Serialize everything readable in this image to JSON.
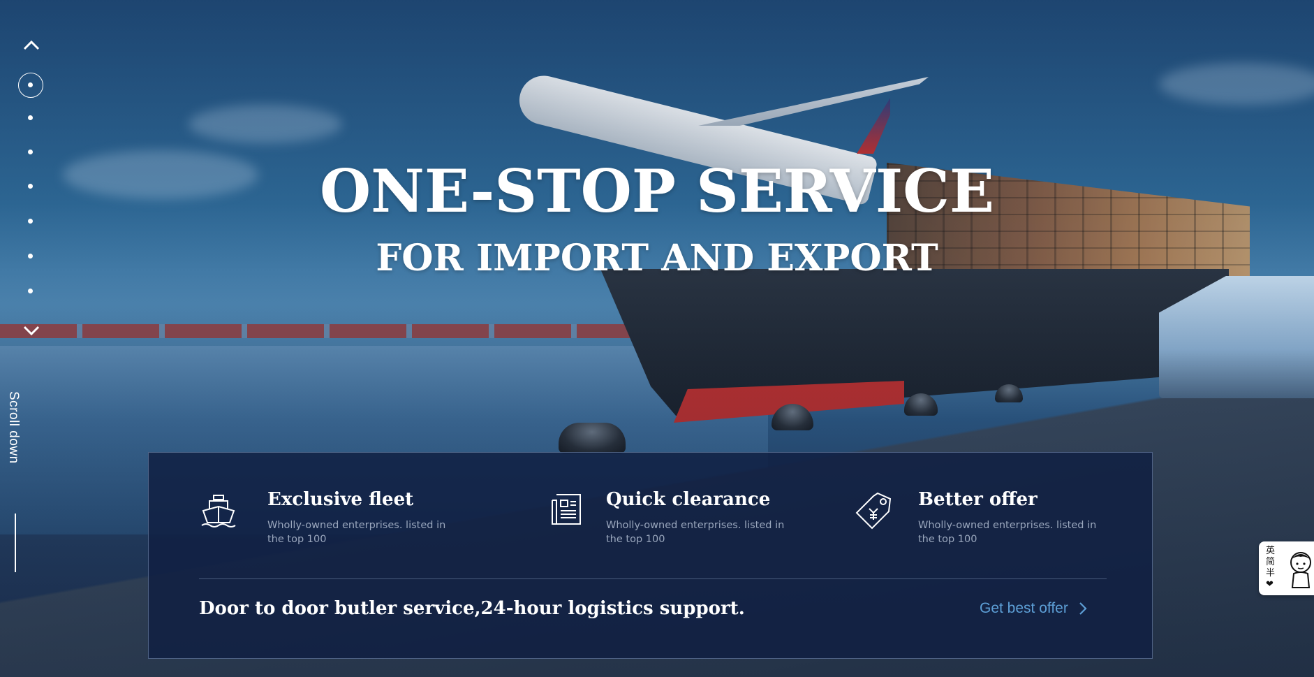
{
  "hero": {
    "headline": "ONE-STOP SERVICE",
    "subheadline": "FOR IMPORT AND EXPORT"
  },
  "side_nav": {
    "scroll_label": "Scroll down",
    "dot_count": 7,
    "active_index": 0
  },
  "features": [
    {
      "icon": "ship-icon",
      "title": "Exclusive fleet",
      "description": "Wholly-owned enterprises. listed in the top 100"
    },
    {
      "icon": "document-icon",
      "title": "Quick clearance",
      "description": "Wholly-owned enterprises. listed in the top 100"
    },
    {
      "icon": "price-tag-icon",
      "title": "Better offer",
      "description": "Wholly-owned enterprises. listed in the top 100"
    }
  ],
  "panel": {
    "tagline": "Door to door butler service,24-hour logistics support.",
    "cta_label": "Get best offer"
  },
  "widget": {
    "text": "英简半❤"
  },
  "colors": {
    "panel_bg": "#102042",
    "cta": "#5d9fd6",
    "desc_text": "#9aa7bd",
    "white": "#ffffff"
  }
}
